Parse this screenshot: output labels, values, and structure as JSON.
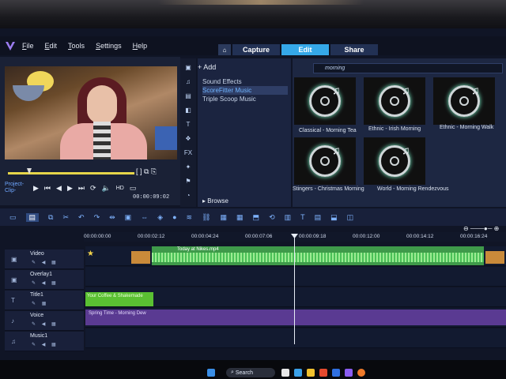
{
  "menubar": {
    "items": [
      "File",
      "Edit",
      "Tools",
      "Settings",
      "Help"
    ]
  },
  "tabs": [
    "Capture",
    "Edit",
    "Share"
  ],
  "player": {
    "project_label": "Project-",
    "clip_label": "Clip-",
    "timecode": "00:00:09:02"
  },
  "library": {
    "add_label": "Add",
    "items": [
      "Sound Effects",
      "ScoreFitter Music",
      "Triple Scoop Music"
    ],
    "selected_index": 1,
    "browse_label": "Browse"
  },
  "search": {
    "value": "morning"
  },
  "media": [
    "Classical - Morning Tea",
    "Ethnic - Irish Morning",
    "Ethnic - Morning Walk",
    "Stingers - Christmas Morning",
    "World - Morning Rendezvous"
  ],
  "ruler": [
    "00:00:00:00",
    "00:00:02:12",
    "00:00:04:24",
    "00:00:07:06",
    "00:00:09:18",
    "00:00:12:00",
    "00:00:14:12",
    "00:00:16:24"
  ],
  "tracks": [
    "Video",
    "Overlay1",
    "Title1",
    "Voice",
    "Music1"
  ],
  "clips": {
    "video_label": "Today at Nikes.mp4",
    "title_label": "Your Coffee & Shakemade",
    "music_label": "Spring Time - Morning Dew"
  },
  "taskbar": {
    "search_label": "Search"
  },
  "colors": {
    "accent": "#35a8e8",
    "video_clip": "#3f9a4a",
    "title_clip": "#5ac032",
    "music_clip": "#5a3a92"
  }
}
